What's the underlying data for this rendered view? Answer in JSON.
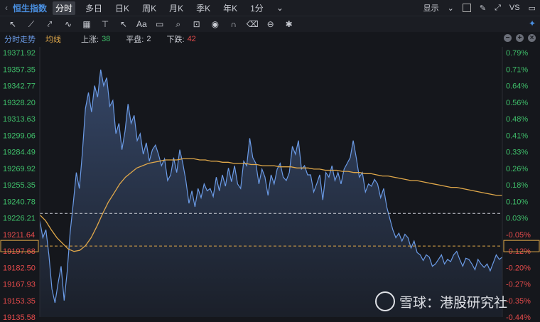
{
  "toolbar": {
    "back_icon": "chevron-left-icon",
    "index_name": "恒生指数",
    "periods": [
      "分时",
      "多日",
      "日K",
      "周K",
      "月K",
      "季K",
      "年K",
      "1分"
    ],
    "active_period": 0,
    "display_label": "显示",
    "right_label": "VS"
  },
  "drawing_tools": [
    "cursor-icon",
    "line-icon",
    "ray-icon",
    "wave-icon",
    "channel-icon",
    "ruler-icon",
    "arrow-icon",
    "text-icon",
    "rect-icon",
    "magnifier-icon",
    "lock-icon",
    "eye-icon",
    "magnet-icon",
    "trash-icon",
    "link-icon",
    "gear-icon"
  ],
  "text_tool_label": "Aa",
  "legend": {
    "series_label": "分时走势",
    "ma_label": "均线",
    "up_label": "上涨:",
    "up_count": "38",
    "flat_label": "平盘:",
    "flat_count": "2",
    "down_label": "下跌:",
    "down_count": "42"
  },
  "watermark": {
    "text": "雪球：港股研究社"
  },
  "chart_data": {
    "type": "line",
    "prev_close": 19226.21,
    "current": 19197.68,
    "ylim": [
      19135.58,
      19371.92
    ],
    "yticks_left": [
      "19371.92",
      "19357.35",
      "19342.77",
      "19328.20",
      "19313.63",
      "19299.06",
      "19284.49",
      "19269.92",
      "19255.35",
      "19240.78",
      "19226.21",
      "19211.64",
      "19197.68",
      "19182.50",
      "19167.93",
      "19153.35",
      "19135.58"
    ],
    "yticks_right": [
      "0.79%",
      "0.71%",
      "0.64%",
      "0.56%",
      "0.48%",
      "0.41%",
      "0.33%",
      "0.26%",
      "0.18%",
      "0.10%",
      "0.03%",
      "-0.05%",
      "-0.12%",
      "-0.20%",
      "-0.27%",
      "-0.35%",
      "-0.44%"
    ],
    "series": [
      {
        "name": "分时走势",
        "values": [
          19220,
          19205,
          19212,
          19190,
          19160,
          19148,
          19165,
          19180,
          19150,
          19175,
          19210,
          19235,
          19262,
          19248,
          19280,
          19318,
          19332,
          19315,
          19338,
          19328,
          19352,
          19338,
          19345,
          19320,
          19325,
          19296,
          19305,
          19282,
          19298,
          19322,
          19305,
          19312,
          19290,
          19296,
          19278,
          19288,
          19272,
          19282,
          19286,
          19278,
          19268,
          19274,
          19255,
          19260,
          19275,
          19262,
          19282,
          19270,
          19255,
          19235,
          19246,
          19232,
          19248,
          19240,
          19252,
          19246,
          19248,
          19241,
          19258,
          19246,
          19260,
          19250,
          19266,
          19254,
          19268,
          19252,
          19248,
          19272,
          19268,
          19292,
          19275,
          19270,
          19252,
          19265,
          19258,
          19242,
          19260,
          19252,
          19265,
          19270,
          19258,
          19255,
          19262,
          19285,
          19278,
          19290,
          19265,
          19268,
          19260,
          19260,
          19245,
          19252,
          19260,
          19238,
          19262,
          19258,
          19268,
          19255,
          19262,
          19252,
          19265,
          19270,
          19275,
          19290,
          19275,
          19258,
          19262,
          19245,
          19252,
          19250,
          19256,
          19252,
          19240,
          19248,
          19232,
          19222,
          19212,
          19205,
          19209,
          19202,
          19208,
          19205,
          19196,
          19202,
          19192,
          19190,
          19185,
          19190,
          19188,
          19180,
          19182,
          19186,
          19190,
          19182,
          19186,
          19184,
          19190,
          19193,
          19186,
          19180,
          19187,
          19186,
          19182,
          19177,
          19186,
          19182,
          19179,
          19182,
          19176,
          19183,
          19190,
          19186,
          19188
        ],
        "color": "#6b9be6"
      },
      {
        "name": "均线",
        "values": [
          19225,
          19220,
          19212,
          19205,
          19200,
          19195,
          19193,
          19194,
          19198,
          19205,
          19215,
          19226,
          19236,
          19244,
          19252,
          19258,
          19262,
          19266,
          19268,
          19270,
          19271,
          19272,
          19273,
          19273,
          19273,
          19274,
          19274,
          19274,
          19273,
          19273,
          19272,
          19272,
          19271,
          19271,
          19270,
          19270,
          19270,
          19269,
          19269,
          19268,
          19268,
          19268,
          19267,
          19267,
          19267,
          19266,
          19266,
          19266,
          19265,
          19265,
          19264,
          19264,
          19264,
          19263,
          19263,
          19262,
          19262,
          19261,
          19261,
          19260,
          19259,
          19259,
          19258,
          19257,
          19256,
          19255,
          19255,
          19254,
          19253,
          19252,
          19251,
          19250,
          19249,
          19249,
          19248,
          19247,
          19246,
          19245,
          19244,
          19243,
          19242,
          19242
        ],
        "color": "#e0a84a"
      }
    ]
  }
}
